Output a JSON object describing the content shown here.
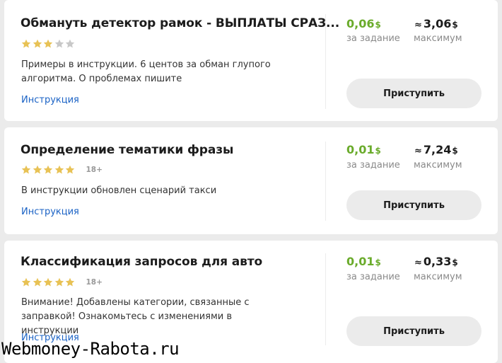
{
  "colors": {
    "price_green": "#6aab2b",
    "link_blue": "#1a62c5",
    "star_gold": "#e8c255",
    "star_gray": "#c8c8c8",
    "button_bg": "#ebebeb"
  },
  "tasks": [
    {
      "title": "Обмануть детектор рамок - ВЫПЛАТЫ СРАЗ...",
      "rating": 3,
      "rating_max": 5,
      "age_label": "",
      "description": "Примеры в инструкции. 6 центов за обман глупого алгоритма. О проблемах пишите",
      "instruction_link": "Инструкция",
      "price": "0,06",
      "currency": "$",
      "price_label": "за задание",
      "approx_symbol": "≈",
      "max": "3,06",
      "max_label": "максимум",
      "button_label": "Приступить"
    },
    {
      "title": "Определение тематики фразы",
      "rating": 5,
      "rating_max": 5,
      "age_label": "18+",
      "description": "В инструкции обновлен сценарий такси",
      "instruction_link": "Инструкция",
      "price": "0,01",
      "currency": "$",
      "price_label": "за задание",
      "approx_symbol": "≈",
      "max": "7,24",
      "max_label": "максимум",
      "button_label": "Приступить"
    },
    {
      "title": "Классификация запросов для авто",
      "rating": 5,
      "rating_max": 5,
      "age_label": "18+",
      "description": "Внимание! Добавлены категории, связанные с заправкой! Ознакомьтесь с изменениями в инструкции",
      "instruction_link": "Инструкция",
      "price": "0,01",
      "currency": "$",
      "price_label": "за задание",
      "approx_symbol": "≈",
      "max": "0,33",
      "max_label": "максимум",
      "button_label": "Приступить"
    }
  ],
  "watermark": "Webmoney-Rabota.ru"
}
